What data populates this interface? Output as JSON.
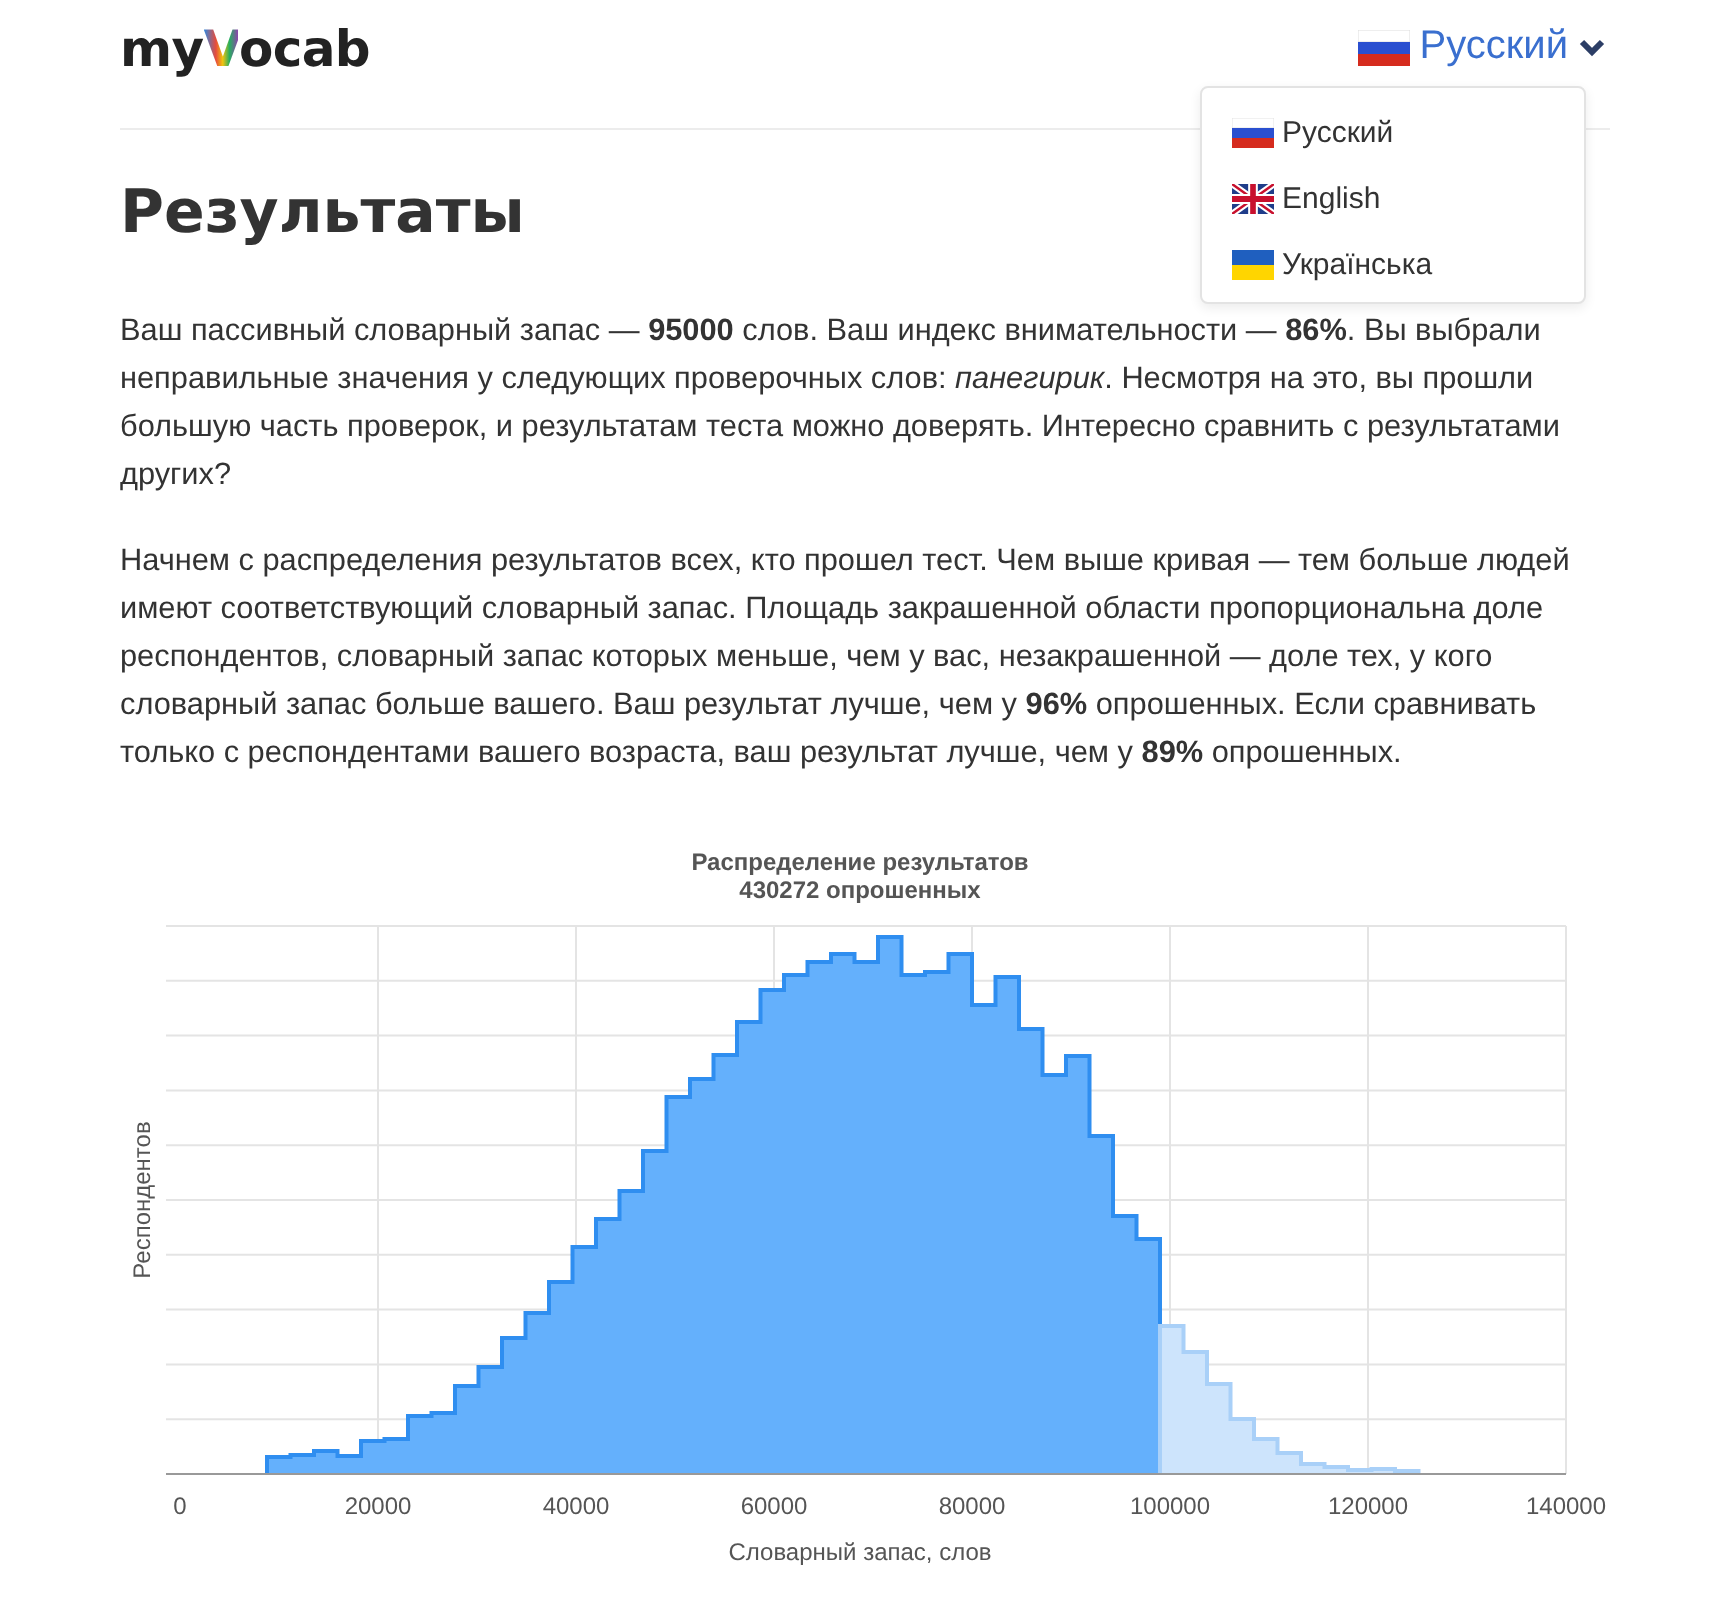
{
  "header": {
    "logo": {
      "prefix": "my",
      "mark": "V",
      "suffix": "ocab"
    },
    "language_menu": {
      "current": "Русский",
      "expanded": true,
      "options": [
        {
          "label": "Русский",
          "kind": "ru"
        },
        {
          "label": "English",
          "kind": "gb"
        },
        {
          "label": "Українська",
          "kind": "ua"
        }
      ]
    }
  },
  "title": "Результаты",
  "paragraphs": [
    "Ваш пассивный словарный запас — **95000** слов. Ваш индекс внимательности — **86%**. Вы выбрали неправильные значения у следующих проверочных слов: *панегирик*. Несмотря на это, вы прошли большую часть проверок, и результатам теста можно доверять. Интересно сравнить с результатами других?",
    "Начнем с распределения результатов всех, кто прошел тест. Чем выше кривая — тем больше людей имеют соответствующий словарный запас. Площадь закрашенной области пропорциональна доле респондентов, словарный запас которых меньше, чем у вас, незакрашенной — доле тех, у кого словарный запас больше вашего. Ваш результат лучше, чем у **96%** опрошенных. Если сравнивать только с респондентами вашего возраста, ваш результат лучше, чем у **89%** опрошенных."
  ],
  "chart": {
    "title": "Распределение результатов",
    "subtitle": "430272 опрошенных",
    "xlabel": "Словарный запас, слов",
    "ylabel": "Респондентов",
    "x_tick_labels": [
      "0",
      "20000",
      "40000",
      "60000",
      "80000",
      "100000",
      "120000",
      "140000"
    ]
  }
}
